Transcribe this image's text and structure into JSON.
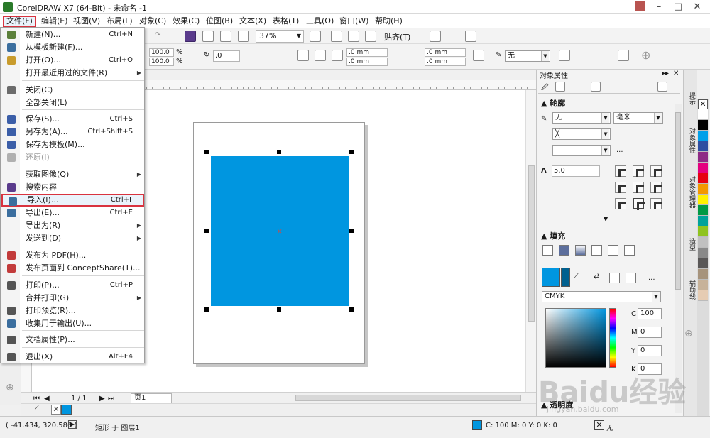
{
  "window": {
    "title": "CorelDRAW X7 (64-Bit) - 未命名 -1"
  },
  "menubar": {
    "items": [
      "文件(F)",
      "编辑(E)",
      "视图(V)",
      "布局(L)",
      "对象(C)",
      "效果(C)",
      "位图(B)",
      "文本(X)",
      "表格(T)",
      "工具(O)",
      "窗口(W)",
      "帮助(H)"
    ]
  },
  "toolbar": {
    "zoom": "37%",
    "snap": "贴齐(T)",
    "scale_x": "100.0",
    "scale_y": "100.0",
    "rotation": ".0",
    "corner1": ".0 mm",
    "corner2": ".0 mm",
    "corner3": ".0 mm",
    "corner4": ".0 mm",
    "outline": "无"
  },
  "file_menu": {
    "items": [
      {
        "label": "新建(N)...",
        "shortcut": "Ctrl+N"
      },
      {
        "label": "从模板新建(F)...",
        "shortcut": ""
      },
      {
        "label": "打开(O)...",
        "shortcut": "Ctrl+O"
      },
      {
        "label": "打开最近用过的文件(R)",
        "shortcut": ""
      },
      {
        "label": "关闭(C)",
        "shortcut": ""
      },
      {
        "label": "全部关闭(L)",
        "shortcut": ""
      },
      {
        "label": "保存(S)...",
        "shortcut": "Ctrl+S"
      },
      {
        "label": "另存为(A)...",
        "shortcut": "Ctrl+Shift+S"
      },
      {
        "label": "保存为模板(M)...",
        "shortcut": ""
      },
      {
        "label": "还原(I)",
        "shortcut": ""
      },
      {
        "label": "获取图像(Q)",
        "shortcut": ""
      },
      {
        "label": "搜索内容",
        "shortcut": ""
      },
      {
        "label": "导入(I)...",
        "shortcut": "Ctrl+I"
      },
      {
        "label": "导出(E)...",
        "shortcut": "Ctrl+E"
      },
      {
        "label": "导出为(R)",
        "shortcut": ""
      },
      {
        "label": "发送到(D)",
        "shortcut": ""
      },
      {
        "label": "发布为 PDF(H)...",
        "shortcut": ""
      },
      {
        "label": "发布页面到 ConceptShare(T)...",
        "shortcut": ""
      },
      {
        "label": "打印(P)...",
        "shortcut": "Ctrl+P"
      },
      {
        "label": "合并打印(G)",
        "shortcut": ""
      },
      {
        "label": "打印预览(R)...",
        "shortcut": ""
      },
      {
        "label": "收集用于输出(U)...",
        "shortcut": ""
      },
      {
        "label": "文档属性(P)...",
        "shortcut": ""
      },
      {
        "label": "退出(X)",
        "shortcut": "Alt+F4"
      }
    ]
  },
  "docker": {
    "title": "对象属性",
    "outline_heading": "轮廓",
    "outline_width": "无",
    "outline_unit": "毫米",
    "miter": "5.0",
    "fill_heading": "填充",
    "color_model": "CMYK",
    "cmyk": {
      "c_label": "C",
      "c": "100",
      "m_label": "M",
      "m": "0",
      "y_label": "Y",
      "y": "0",
      "k_label": "K",
      "k": "0"
    },
    "transparency_heading": "透明度",
    "more": "..."
  },
  "vertical_tabs": [
    "提示",
    "对象属性",
    "对象管理器",
    "造型",
    "辅助线"
  ],
  "page_nav": {
    "count": "1 / 1",
    "tab": "页1"
  },
  "status": {
    "coords": "( -41.434, 320.586 )",
    "object": "矩形 于 图层1",
    "fill": "C: 100 M: 0 Y: 0 K: 0",
    "outline": "无"
  },
  "colors": {
    "fill_cyan": "#0096e0",
    "highlight_red": "#d9333f"
  },
  "palette": [
    "#ffffff",
    "#000000",
    "#00a0e9",
    "#2e4ea1",
    "#8e2b85",
    "#e4007f",
    "#e60012",
    "#f39800",
    "#fff100",
    "#009944",
    "#00a29a",
    "#8fc31f",
    "#c0c0c0",
    "#898989",
    "#595757",
    "#a6937c",
    "#c7b299",
    "#e6ccb3"
  ],
  "watermark": {
    "main": "Baidu经验",
    "sub": "jingyan.baidu.com"
  }
}
